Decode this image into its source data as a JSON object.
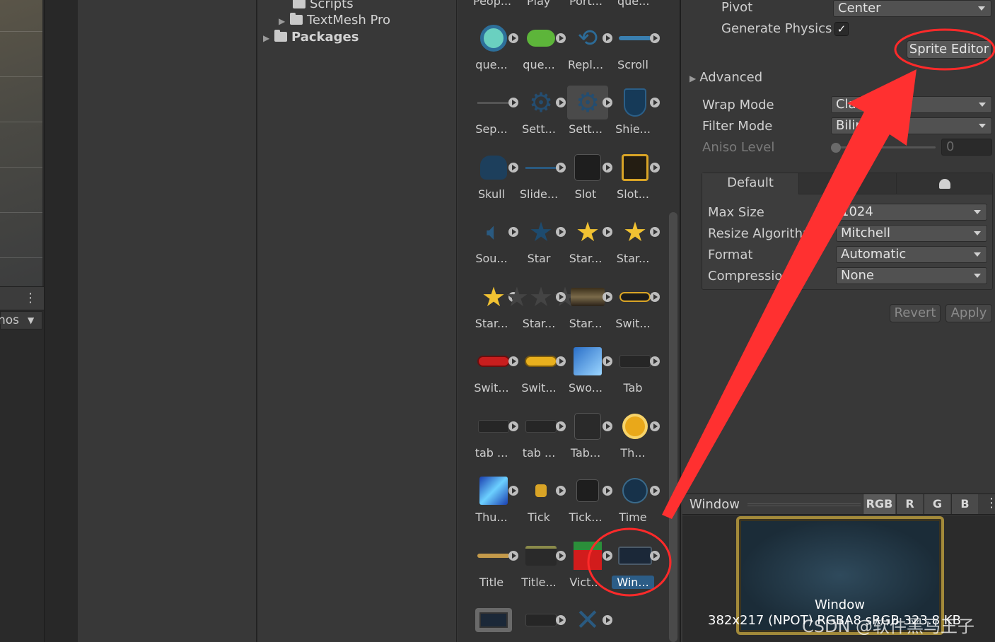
{
  "scene": {
    "gizmos_label": "nos",
    "more_icon": "kebab-icon"
  },
  "project_tree": {
    "items": [
      {
        "label": "Scripts",
        "expanded": false
      },
      {
        "label": "TextMesh Pro",
        "expanded": false
      },
      {
        "label": "Packages",
        "expanded": false
      }
    ]
  },
  "assets": {
    "top_row_labels": [
      "Peop...",
      "Play",
      "Port...",
      "que..."
    ],
    "items": [
      {
        "label": "que...",
        "icon": "ring-icon"
      },
      {
        "label": "que...",
        "icon": "leaf-icon"
      },
      {
        "label": "Repl...",
        "icon": "replay-icon"
      },
      {
        "label": "Scroll",
        "icon": "scrollbar-icon"
      },
      {
        "label": "Sep...",
        "icon": "separator-icon"
      },
      {
        "label": "Sett...",
        "icon": "gear-icon"
      },
      {
        "label": "Sett...",
        "icon": "gear-icon"
      },
      {
        "label": "Shie...",
        "icon": "shield-icon"
      },
      {
        "label": "Skull",
        "icon": "skull-icon"
      },
      {
        "label": "Slide...",
        "icon": "slider-icon"
      },
      {
        "label": "Slot",
        "icon": "slot-icon"
      },
      {
        "label": "Slot...",
        "icon": "slot-gold-icon"
      },
      {
        "label": "Sou...",
        "icon": "speaker-icon"
      },
      {
        "label": "Star",
        "icon": "star-icon"
      },
      {
        "label": "Star...",
        "icon": "star-gold-icon"
      },
      {
        "label": "Star...",
        "icon": "star-gold-icon"
      },
      {
        "label": "Star...",
        "icon": "star-gold-icon"
      },
      {
        "label": "Star...",
        "icon": "star-dark-icon"
      },
      {
        "label": "Star...",
        "icon": "starfield-icon"
      },
      {
        "label": "Swit...",
        "icon": "switch-outline-icon"
      },
      {
        "label": "Swit...",
        "icon": "switch-red-icon"
      },
      {
        "label": "Swit...",
        "icon": "switch-yellow-icon"
      },
      {
        "label": "Swo...",
        "icon": "sword-icon"
      },
      {
        "label": "Tab",
        "icon": "tab-icon"
      },
      {
        "label": "tab ...",
        "icon": "tab-icon"
      },
      {
        "label": "tab ...",
        "icon": "tab-icon"
      },
      {
        "label": "Tab...",
        "icon": "tab-square-icon"
      },
      {
        "label": "Th...",
        "icon": "coin-icon"
      },
      {
        "label": "Thu...",
        "icon": "thunder-icon"
      },
      {
        "label": "Tick",
        "icon": "tick-icon"
      },
      {
        "label": "Tick...",
        "icon": "tick-box-icon"
      },
      {
        "label": "Time",
        "icon": "clock-icon"
      },
      {
        "label": "Title",
        "icon": "title-bar-icon"
      },
      {
        "label": "Title...",
        "icon": "title-frame-icon"
      },
      {
        "label": "Vict...",
        "icon": "victory-icon"
      },
      {
        "label": "Win...",
        "icon": "window-icon",
        "selected": true
      }
    ]
  },
  "inspector": {
    "pivot_label": "Pivot",
    "pivot_value": "Center",
    "generate_physics_label": "Generate Physics",
    "generate_physics_checked": "✓",
    "sprite_editor_button": "Sprite Editor",
    "advanced_label": "Advanced",
    "wrap_mode_label": "Wrap Mode",
    "wrap_mode_value": "Clamp",
    "filter_mode_label": "Filter Mode",
    "filter_mode_value": "Bilinear",
    "aniso_level_label": "Aniso Level",
    "aniso_level_value": "0",
    "platform_tabs": [
      "Default",
      "",
      ""
    ],
    "max_size_label": "Max Size",
    "max_size_value": "1024",
    "resize_algorithm_label": "Resize Algorithm",
    "resize_algorithm_value": "Mitchell",
    "format_label": "Format",
    "format_value": "Automatic",
    "compression_label": "Compression",
    "compression_value": "None",
    "revert_button": "Revert",
    "apply_button": "Apply"
  },
  "preview": {
    "title": "Window",
    "channels": [
      "RGB",
      "R",
      "G",
      "B"
    ],
    "sprite_name": "Window",
    "info": "382x217 (NPOT) RGBA8 sRGB  323.8 KB",
    "watermark": "CSDN @软件黑马王子"
  },
  "annotation": {
    "color": "#ff2a2a"
  }
}
